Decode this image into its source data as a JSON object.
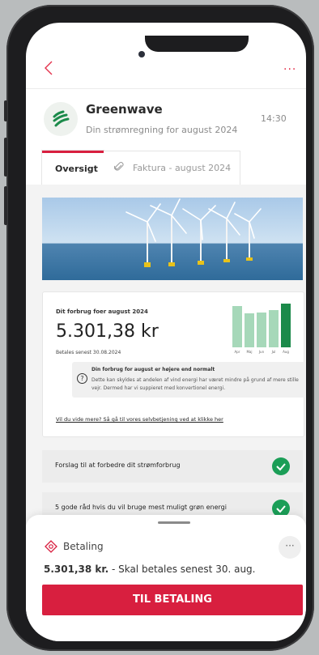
{
  "colors": {
    "accent": "#d81f3f",
    "success": "#1b9e57",
    "bar": "#a6d8b9",
    "bar_current": "#1b8a4a"
  },
  "header": {
    "back_icon": "chevron-left-icon",
    "more_icon": "more-horizontal-icon"
  },
  "message": {
    "sender": "Greenwave",
    "subject": "Din strømregning for august 2024",
    "time": "14:30",
    "logo_icon": "greenwave-logo"
  },
  "tabs": [
    {
      "label": "Oversigt",
      "active": true
    },
    {
      "label": "Faktura - august 2024",
      "icon": "paperclip-icon",
      "active": false
    }
  ],
  "summary_card": {
    "title": "Dit forbrug foer august 2024",
    "amount": "5.301,38 kr",
    "due": "Betales senest 30.08.2024",
    "info_title": "Din forbrug for august er højere end normalt",
    "info_body": "Dette kan skyldes at andelen af vind energi har været mindre på grund af mere stille vejr. Dermed har vi suppieret med konvertionel energi.",
    "link": "Vil du vide mere? Så gå til vores selvbetjening ved at klikke her"
  },
  "chart_data": {
    "type": "bar",
    "categories": [
      "Apr",
      "Maj",
      "Jun",
      "Jul",
      "Aug"
    ],
    "values": [
      0.95,
      0.78,
      0.8,
      0.85,
      1.0
    ],
    "highlight_index": 4
  },
  "list_items": [
    {
      "label": "Forslag til at forbedre dit strømforbrug",
      "status_icon": "checkmark-icon"
    },
    {
      "label": "5 gode råd hvis du vil bruge mest muligt grøn energi",
      "status_icon": "checkmark-icon"
    }
  ],
  "payment": {
    "label": "Betaling",
    "amount": "5.301,38 kr.",
    "due_text": " - Skal betales senest 30. aug.",
    "button": "TIL BETALING",
    "more_label": "···"
  }
}
